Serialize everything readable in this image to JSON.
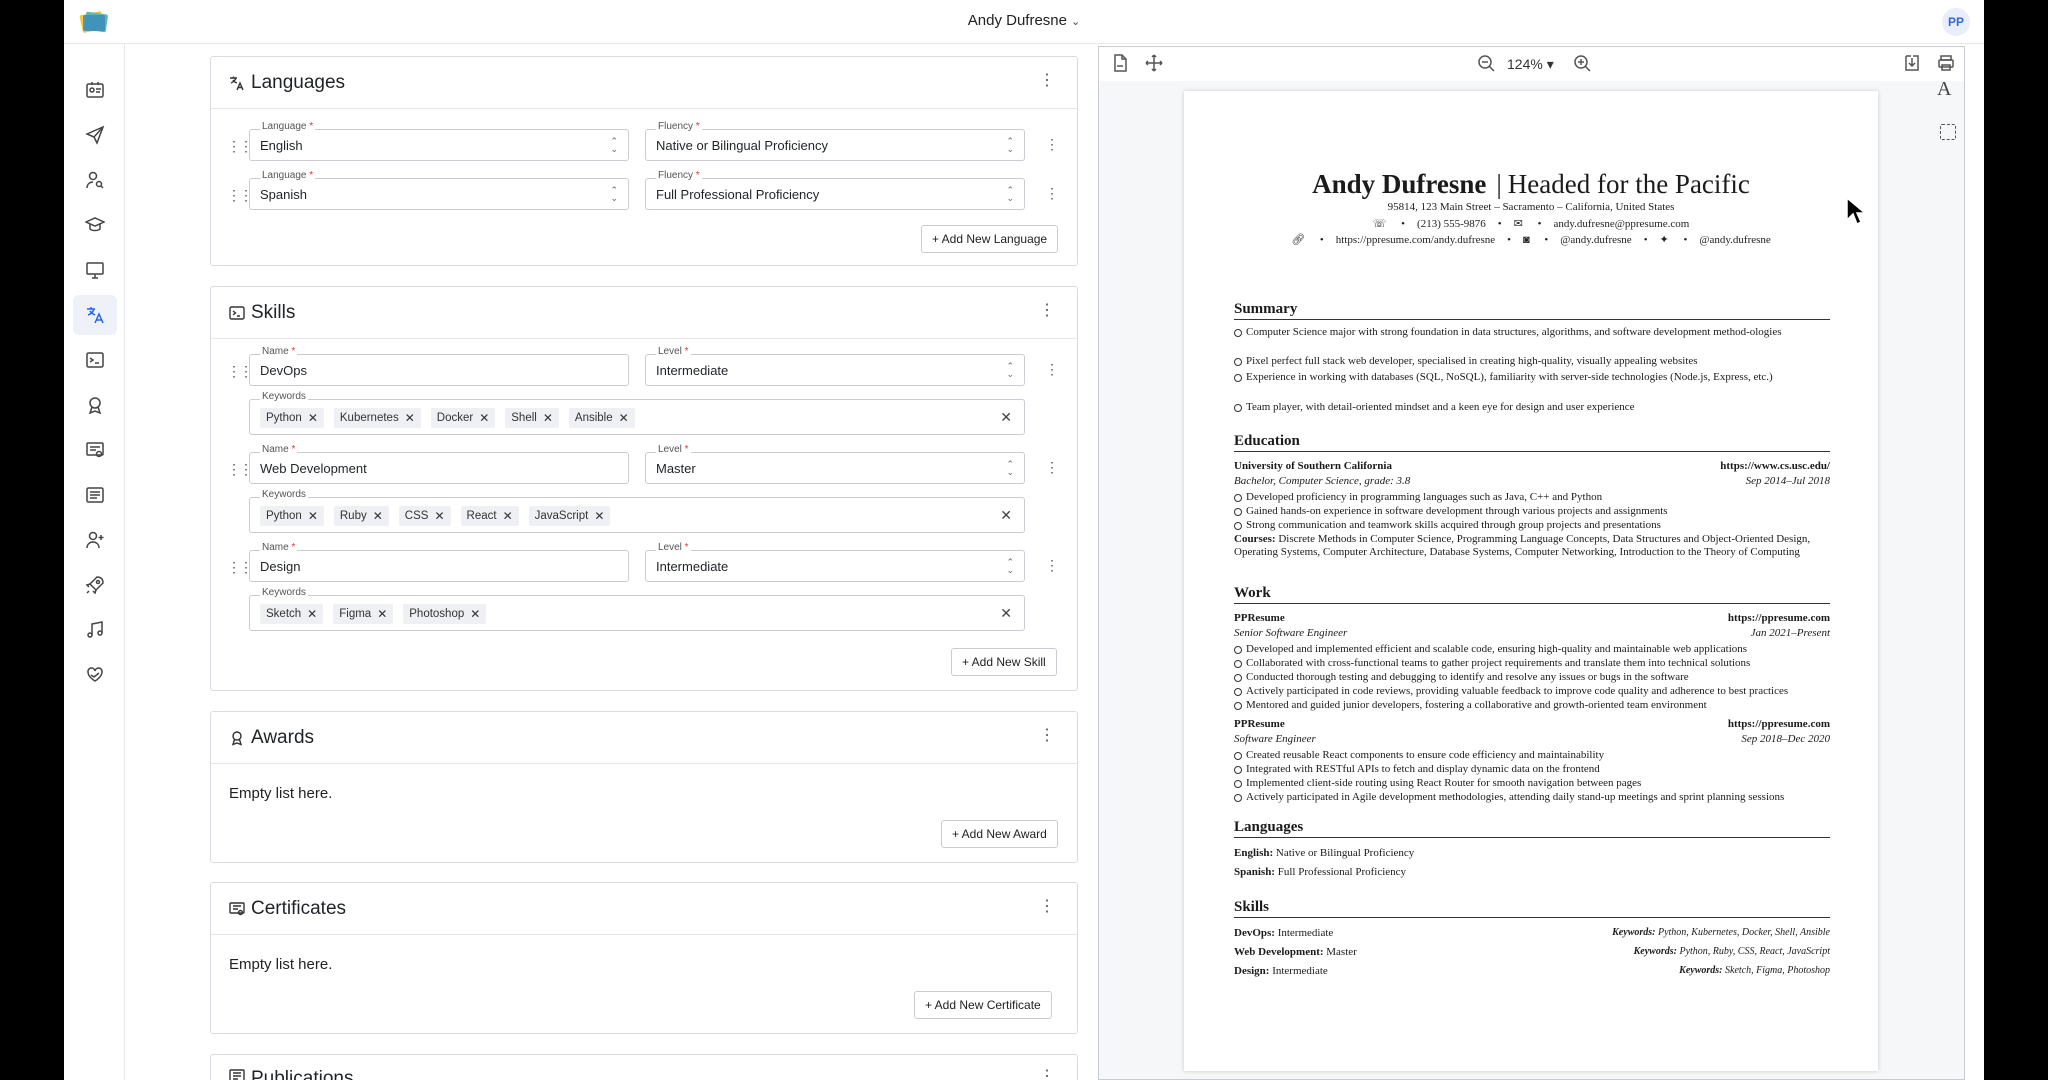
{
  "topbar": {
    "user_name": "Andy Dufresne",
    "chevron": "⌄",
    "avatar_initials": "PP"
  },
  "nav": [
    "profile-card-icon",
    "send-icon",
    "user-search-icon",
    "graduation-cap-icon",
    "monitor-icon",
    "translate-icon",
    "terminal-icon",
    "award-icon",
    "certificate-icon",
    "list-icon",
    "user-plus-icon",
    "rocket-icon",
    "music-icon",
    "heart-hand-icon"
  ],
  "languages": {
    "title": "Languages",
    "rows": [
      {
        "language_label": "Language",
        "language": "English",
        "fluency_label": "Fluency",
        "fluency": "Native or Bilingual Proficiency"
      },
      {
        "language_label": "Language",
        "language": "Spanish",
        "fluency_label": "Fluency",
        "fluency": "Full Professional Proficiency"
      }
    ],
    "add_label": "+ Add New Language"
  },
  "skills": {
    "title": "Skills",
    "rows": [
      {
        "name_label": "Name",
        "name": "DevOps",
        "level_label": "Level",
        "level": "Intermediate",
        "keywords_label": "Keywords",
        "keywords": [
          "Python",
          "Kubernetes",
          "Docker",
          "Shell",
          "Ansible"
        ]
      },
      {
        "name_label": "Name",
        "name": "Web Development",
        "level_label": "Level",
        "level": "Master",
        "keywords_label": "Keywords",
        "keywords": [
          "Python",
          "Ruby",
          "CSS",
          "React",
          "JavaScript"
        ]
      },
      {
        "name_label": "Name",
        "name": "Design",
        "level_label": "Level",
        "level": "Intermediate",
        "keywords_label": "Keywords",
        "keywords": [
          "Sketch",
          "Figma",
          "Photoshop"
        ]
      }
    ],
    "add_label": "+ Add New Skill"
  },
  "awards": {
    "title": "Awards",
    "empty": "Empty list here.",
    "add_label": "+ Add New Award"
  },
  "certificates": {
    "title": "Certificates",
    "empty": "Empty list here.",
    "add_label": "+ Add New Certificate"
  },
  "publications": {
    "title": "Publications"
  },
  "preview": {
    "zoom": "124%",
    "name": "Andy Dufresne",
    "headline": "Headed for the Pacific",
    "address": "95814, 123 Main Street – Sacramento – California, United States",
    "phone": "(213) 555-9876",
    "email": "andy.dufresne@ppresume.com",
    "website": "https://ppresume.com/andy.dufresne",
    "mastodon": "@andy.dufresne",
    "twitter": "@andy.dufresne",
    "summary_title": "Summary",
    "summary": [
      "Computer Science major with strong foundation in data structures, algorithms, and software development method-ologies",
      "Pixel perfect full stack web developer, specialised in creating high-quality, visually appealing websites",
      "Experience in working with databases (SQL, NoSQL), familiarity with server-side technologies (Node.js, Express, etc.)",
      "Team player, with detail-oriented mindset and a keen eye for design and user experience"
    ],
    "education_title": "Education",
    "edu": {
      "school": "University of Southern California",
      "url": "https://www.cs.usc.edu/",
      "degree": "Bachelor, Computer Science, grade: 3.8",
      "dates": "Sep 2014–Jul 2018",
      "items": [
        "Developed proficiency in programming languages such as Java, C++ and Python",
        "Gained hands-on experience in software development through various projects and assignments",
        "Strong communication and teamwork skills acquired through group projects and presentations"
      ],
      "courses_label": "Courses:",
      "courses": "Discrete Methods in Computer Science, Programming Language Concepts, Data Structures and Object-Oriented Design, Operating Systems, Computer Architecture, Database Systems, Computer Networking, Introduction to the Theory of Computing"
    },
    "work_title": "Work",
    "jobs": [
      {
        "company": "PPResume",
        "url": "https://ppresume.com",
        "position": "Senior Software Engineer",
        "dates": "Jan 2021–Present",
        "items": [
          "Developed and implemented efficient and scalable code, ensuring high-quality and maintainable web applications",
          "Collaborated with cross-functional teams to gather project requirements and translate them into technical solutions",
          "Conducted thorough testing and debugging to identify and resolve any issues or bugs in the software",
          "Actively participated in code reviews, providing valuable feedback to improve code quality and adherence to best practices",
          "Mentored and guided junior developers, fostering a collaborative and growth-oriented team environment"
        ]
      },
      {
        "company": "PPResume",
        "url": "https://ppresume.com",
        "position": "Software Engineer",
        "dates": "Sep 2018–Dec 2020",
        "items": [
          "Created reusable React components to ensure code efficiency and maintainability",
          "Integrated with RESTful APIs to fetch and display dynamic data on the frontend",
          "Implemented client-side routing using React Router for smooth navigation between pages",
          "Actively participated in Agile development methodologies, attending daily stand-up meetings and sprint planning sessions"
        ]
      }
    ],
    "languages_title": "Languages",
    "lang_lines": [
      {
        "name": "English:",
        "value": "Native or Bilingual Proficiency"
      },
      {
        "name": "Spanish:",
        "value": "Full Professional Proficiency"
      }
    ],
    "skills_title": "Skills",
    "skill_lines": [
      {
        "name": "DevOps:",
        "level": "Intermediate",
        "kw_label": "Keywords:",
        "kw": "Python, Kubernetes, Docker, Shell, Ansible"
      },
      {
        "name": "Web Development:",
        "level": "Master",
        "kw_label": "Keywords:",
        "kw": "Python, Ruby, CSS, React, JavaScript"
      },
      {
        "name": "Design:",
        "level": "Intermediate",
        "kw_label": "Keywords:",
        "kw": "Sketch, Figma, Photoshop"
      }
    ]
  }
}
